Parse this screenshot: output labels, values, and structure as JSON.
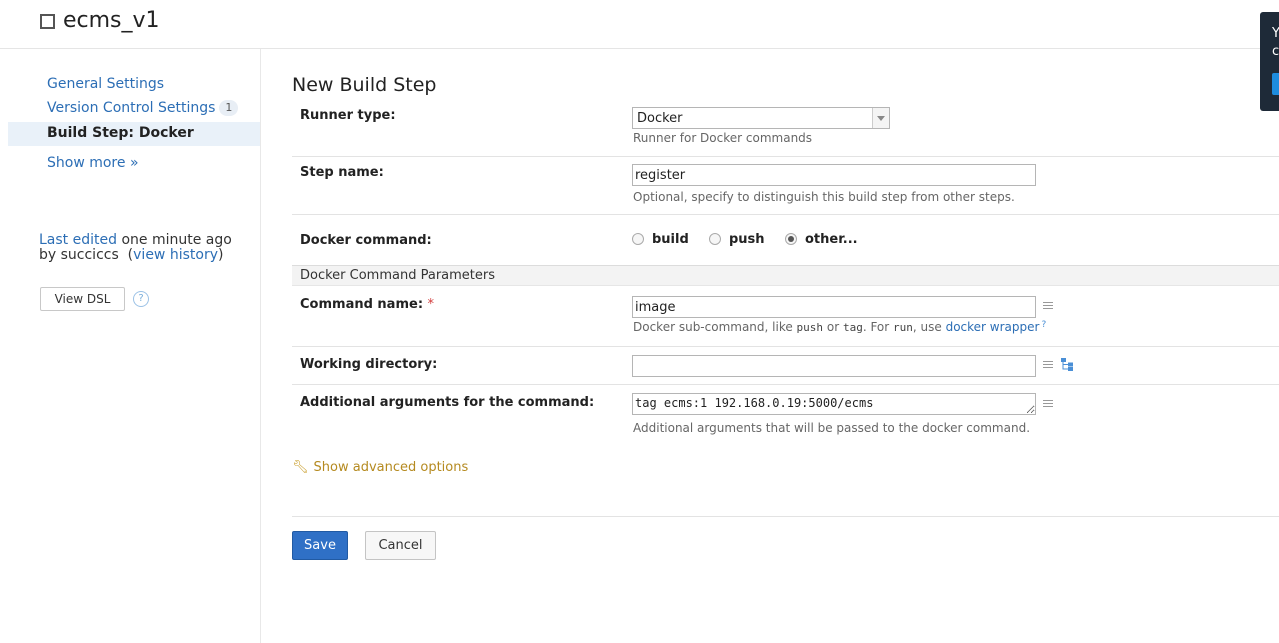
{
  "header": {
    "title": "ecms_v1",
    "icon": "square-icon"
  },
  "toast": {
    "line1": "Y",
    "line2": "c"
  },
  "sidebar": {
    "items": [
      {
        "label": "General Settings"
      },
      {
        "label": "Version Control Settings",
        "badge": "1"
      },
      {
        "label": "Build Step: Docker",
        "active": true
      },
      {
        "label": "Show more »"
      }
    ],
    "last_edited": {
      "link": "Last edited",
      "when": " one minute ago",
      "by": "by succiccs",
      "history_link": "view history"
    },
    "view_dsl": "View DSL",
    "help": "?"
  },
  "main": {
    "title": "New Build Step",
    "runner_type": {
      "label": "Runner type:",
      "value": "Docker",
      "hint": "Runner for Docker commands"
    },
    "step_name": {
      "label": "Step name:",
      "value": "register",
      "hint": "Optional, specify to distinguish this build step from other steps."
    },
    "docker_command": {
      "label": "Docker command:",
      "options": [
        "build",
        "push",
        "other..."
      ],
      "selected": "other..."
    },
    "section": "Docker Command Parameters",
    "command_name": {
      "label": "Command name:",
      "required": "*",
      "value": "image",
      "hint_pre": "Docker sub-command, like ",
      "hint_code1": "push",
      "hint_mid1": " or ",
      "hint_code2": "tag",
      "hint_mid2": ". For ",
      "hint_code3": "run",
      "hint_mid3": ", use ",
      "hint_link": "docker wrapper"
    },
    "working_directory": {
      "label": "Working directory:",
      "value": ""
    },
    "additional_args": {
      "label": "Additional arguments for the command:",
      "value": "tag ecms:1 192.168.0.19:5000/ecms",
      "hint": "Additional arguments that will be passed to the docker command."
    },
    "advanced": "Show advanced options",
    "save": "Save",
    "cancel": "Cancel"
  },
  "colors": {
    "link": "#2c6eb5",
    "primary": "#2f70c6",
    "advanced": "#b58a20"
  }
}
